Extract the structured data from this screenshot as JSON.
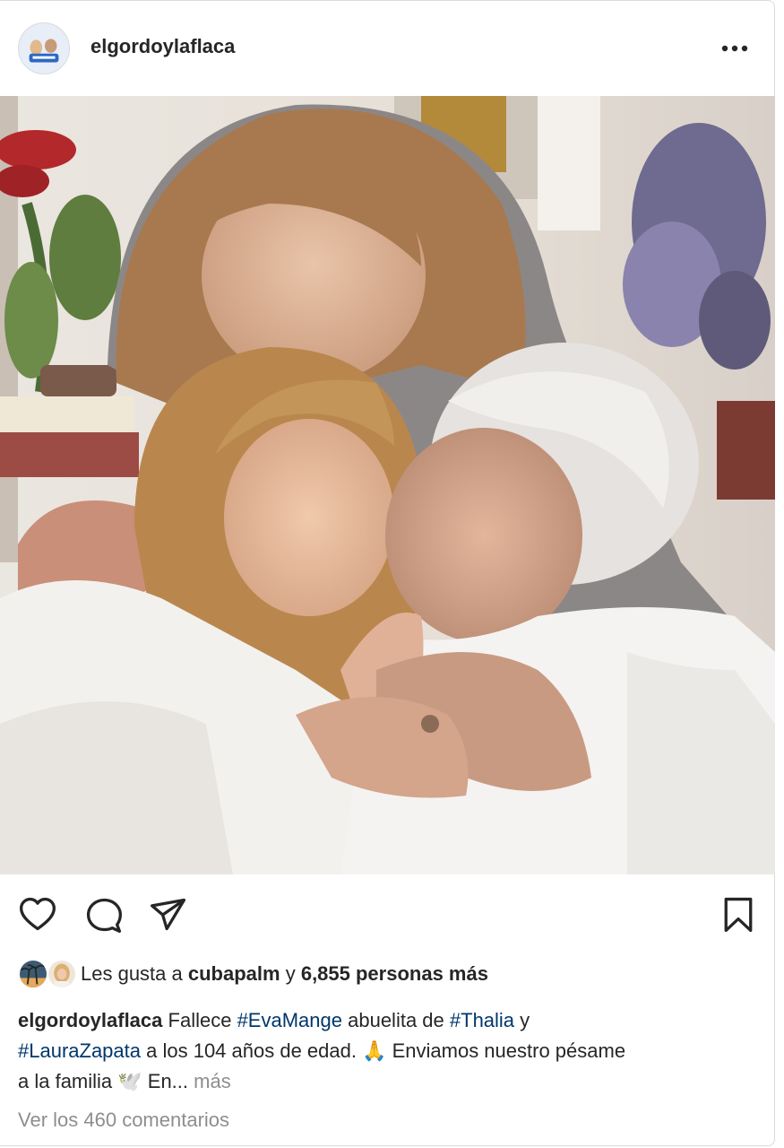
{
  "post": {
    "username": "elgordoylaflaca",
    "icons": {
      "more": "more-horizontal-icon",
      "like": "heart-outline-icon",
      "comment": "comment-bubble-icon",
      "share": "paper-plane-icon",
      "save": "bookmark-outline-icon"
    }
  },
  "likes": {
    "prefix": "Les gusta a",
    "user": "cubapalm",
    "connector": "y",
    "count_text": "6,855 personas más"
  },
  "caption": {
    "username": "elgordoylaflaca",
    "t1": "Fallece",
    "tag1": "#EvaMange",
    "t2": "abuelita de",
    "tag2": "#Thalia",
    "t3": "y",
    "tag3": "#LauraZapata",
    "t4": "a los 104 años de edad. 🙏 Enviamos nuestro pésame",
    "t5": "a la familia 🕊️ En...",
    "more": "más"
  },
  "comments_link": "Ver los 460 comentarios",
  "colors": {
    "text": "#262626",
    "hashtag": "#00376b",
    "secondary": "#8e8e8e",
    "border": "#dbdbdb"
  }
}
